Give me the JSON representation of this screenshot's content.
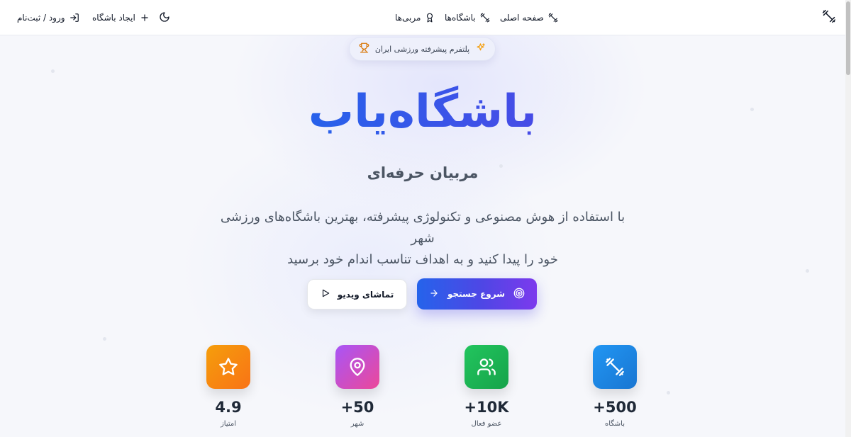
{
  "nav": {
    "home": "صفحه اصلی",
    "clubs": "باشگاه‌ها",
    "coaches": "مربی‌ها",
    "login": "ورود / ثبت‌نام",
    "create_club": "ایجاد باشگاه"
  },
  "hero": {
    "badge": "پلتفرم پیشرفته ورزشی ایران",
    "title": "باشگاه‌یاب",
    "subtitle": "مربیان حرفه‌ای",
    "description_line1": "با استفاده از هوش مصنوعی و تکنولوژی پیشرفته، بهترین باشگاه‌های ورزشی شهر",
    "description_line2": "خود را پیدا کنید و به اهداف تناسب اندام خود برسید",
    "primary_button": "شروع جستجو",
    "secondary_button": "تماشای ویدیو"
  },
  "stats": [
    {
      "value": "+500",
      "label": "باشگاه",
      "icon": "dumbbell-icon",
      "color_from": "#2196f3",
      "color_to": "#1976d2"
    },
    {
      "value": "+10K",
      "label": "عضو فعال",
      "icon": "users-icon",
      "color_from": "#22c55e",
      "color_to": "#16a34a"
    },
    {
      "value": "+50",
      "label": "شهر",
      "icon": "map-pin-icon",
      "color_from": "#a855f7",
      "color_to": "#ec4899"
    },
    {
      "value": "4.9",
      "label": "امتیاز",
      "icon": "star-icon",
      "color_from": "#f59e0b",
      "color_to": "#f97316"
    }
  ],
  "colors": {
    "accent": "#4f46e5",
    "title_gradient_start": "#1d4ed8",
    "title_gradient_end": "#6d28d9"
  }
}
